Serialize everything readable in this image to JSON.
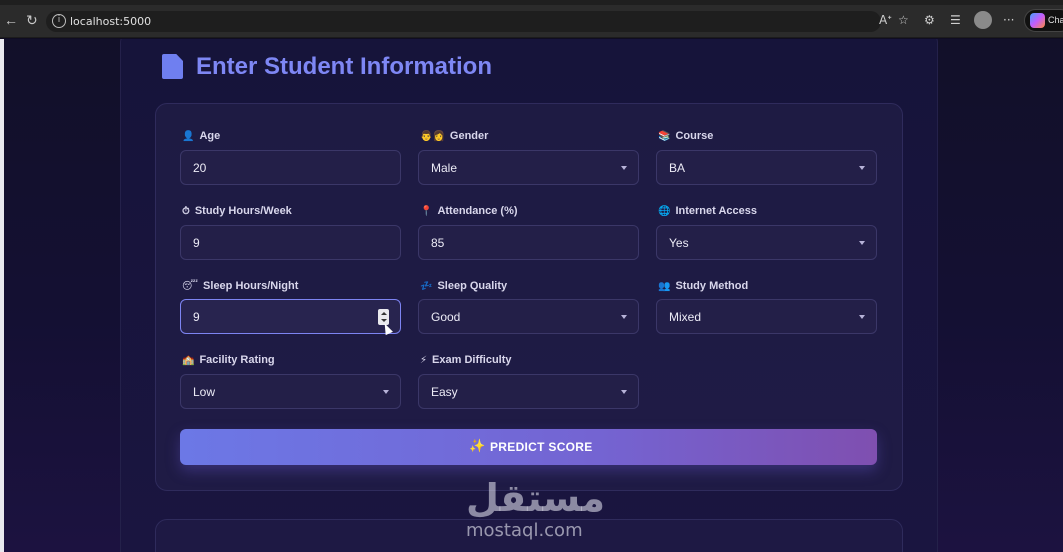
{
  "browser": {
    "url": "localhost:5000",
    "copilot_label": "Cha"
  },
  "page": {
    "title": "Enter Student Information",
    "fields": [
      {
        "label": "Age",
        "icon": "person-icon",
        "icon_glyph": "👤",
        "type": "number",
        "value": "20"
      },
      {
        "label": "Gender",
        "icon": "gender-icon",
        "icon_glyph": "👨👩",
        "type": "select",
        "value": "Male"
      },
      {
        "label": "Course",
        "icon": "books-icon",
        "icon_glyph": "📚",
        "type": "select",
        "value": "BA"
      },
      {
        "label": "Study Hours/Week",
        "icon": "stopwatch-icon",
        "icon_glyph": "⏱",
        "type": "number",
        "value": "9"
      },
      {
        "label": "Attendance (%)",
        "icon": "pin-icon",
        "icon_glyph": "📍",
        "type": "number",
        "value": "85"
      },
      {
        "label": "Internet Access",
        "icon": "globe-icon",
        "icon_glyph": "🌐",
        "type": "select",
        "value": "Yes"
      },
      {
        "label": "Sleep Hours/Night",
        "icon": "sleep-face-icon",
        "icon_glyph": "😴",
        "type": "number",
        "value": "9"
      },
      {
        "label": "Sleep Quality",
        "icon": "zzz-icon",
        "icon_glyph": "💤",
        "type": "select",
        "value": "Good"
      },
      {
        "label": "Study Method",
        "icon": "people-icon",
        "icon_glyph": "👥",
        "type": "select",
        "value": "Mixed"
      },
      {
        "label": "Facility Rating",
        "icon": "building-icon",
        "icon_glyph": "🏫",
        "type": "select",
        "value": "Low"
      },
      {
        "label": "Exam Difficulty",
        "icon": "lightning-icon",
        "icon_glyph": "⚡",
        "type": "select",
        "value": "Easy"
      }
    ],
    "predict_button": "PREDICT SCORE"
  },
  "watermark": {
    "arabic": "مستقل",
    "latin": "mostaql.com"
  }
}
